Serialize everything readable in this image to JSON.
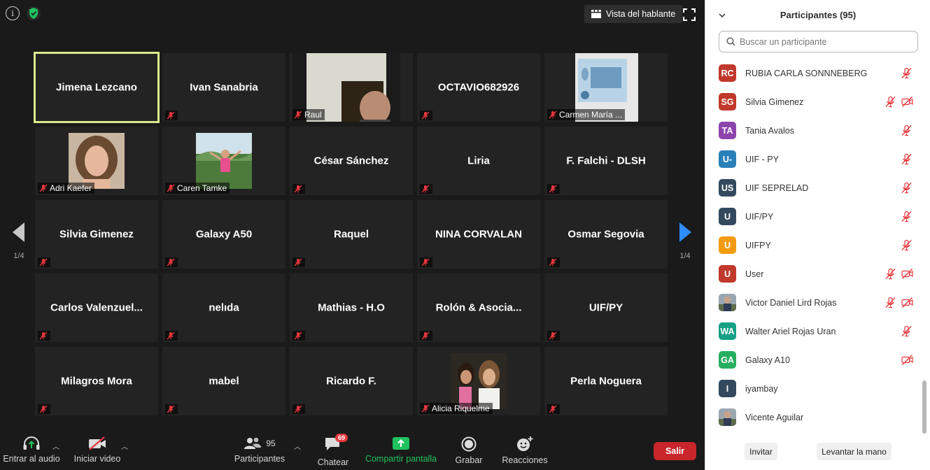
{
  "topbar": {
    "speaker_view_label": "Vista del hablante"
  },
  "grid": {
    "page_indicator_left": "1/4",
    "page_indicator_right": "1/4",
    "tiles": [
      {
        "name": "Jimena Lezcano",
        "active": true
      },
      {
        "name": "Ivan Sanabria"
      },
      {
        "name": "Raul",
        "video": true,
        "label": "Raul"
      },
      {
        "name": "OCTAVIO682926"
      },
      {
        "name": "Carmen María ...",
        "video": true,
        "label": "Carmen María ..."
      },
      {
        "name": "Adri Kaefer",
        "photo": true,
        "label": "Adri Kaefer"
      },
      {
        "name": "Caren Tamke",
        "photo": true,
        "label": "Caren Tamke"
      },
      {
        "name": "César Sánchez"
      },
      {
        "name": "Liria"
      },
      {
        "name": "F. Falchi - DLSH"
      },
      {
        "name": "Silvia Gimenez"
      },
      {
        "name": "Galaxy A50"
      },
      {
        "name": "Raquel"
      },
      {
        "name": "NINA CORVALAN"
      },
      {
        "name": "Osmar Segovia"
      },
      {
        "name": "Carlos  Valenzuel..."
      },
      {
        "name": "nelıda"
      },
      {
        "name": "Mathias - H.O"
      },
      {
        "name": "Rolón & Asocia..."
      },
      {
        "name": "UIF/PY"
      },
      {
        "name": "Milagros Mora"
      },
      {
        "name": "mabel"
      },
      {
        "name": "Ricardo F."
      },
      {
        "name": "Alicia Riquelme",
        "photo": true,
        "label": "Alicia Riquelme"
      },
      {
        "name": "Perla Noguera"
      }
    ]
  },
  "toolbar": {
    "audio_label": "Entrar al audio",
    "video_label": "Iniciar video",
    "participants_label": "Participantes",
    "participants_count": "95",
    "chat_label": "Chatear",
    "chat_badge": "69",
    "share_label": "Compartir pantalla",
    "record_label": "Grabar",
    "reactions_label": "Reacciones",
    "leave_label": "Salir"
  },
  "panel": {
    "title": "Participantes (95)",
    "search_placeholder": "Buscar un participante",
    "participants": [
      {
        "initials": "RC",
        "name": "RUBIA CARLA SONNNEBERG",
        "color": "#c0392b",
        "mic_muted": true,
        "cam_off": false
      },
      {
        "initials": "SG",
        "name": "Silvia Gimenez",
        "color": "#c0392b",
        "mic_muted": true,
        "cam_off": true
      },
      {
        "initials": "TA",
        "name": "Tania Avalos",
        "color": "#8e44ad",
        "mic_muted": true,
        "cam_off": false
      },
      {
        "initials": "U-",
        "name": "UIF - PY",
        "color": "#2980b9",
        "mic_muted": true,
        "cam_off": false
      },
      {
        "initials": "US",
        "name": "UIF SEPRELAD",
        "color": "#34495e",
        "mic_muted": true,
        "cam_off": false
      },
      {
        "initials": "U",
        "name": "UIF/PY",
        "color": "#34495e",
        "mic_muted": true,
        "cam_off": false
      },
      {
        "initials": "U",
        "name": "UIFPY",
        "color": "#f39c12",
        "mic_muted": true,
        "cam_off": false
      },
      {
        "initials": "U",
        "name": "User",
        "color": "#c0392b",
        "mic_muted": true,
        "cam_off": true
      },
      {
        "initials": "",
        "name": "Victor Daniel Lird Rojas",
        "color": "#6b6b6b",
        "photo": true,
        "mic_muted": true,
        "cam_off": true
      },
      {
        "initials": "WA",
        "name": "Walter Ariel Rojas Uran",
        "color": "#16a085",
        "mic_muted": true,
        "cam_off": false
      },
      {
        "initials": "GA",
        "name": "Galaxy A10",
        "color": "#27ae60",
        "mic_muted": false,
        "cam_off": true
      },
      {
        "initials": "I",
        "name": "iyambay",
        "color": "#34495e",
        "mic_muted": false,
        "cam_off": false
      },
      {
        "initials": "",
        "name": "Vicente Aguilar",
        "color": "#8a8a7a",
        "photo": true,
        "mic_muted": false,
        "cam_off": false
      }
    ],
    "invite_label": "Invitar",
    "raise_hand_label": "Levantar la mano"
  }
}
